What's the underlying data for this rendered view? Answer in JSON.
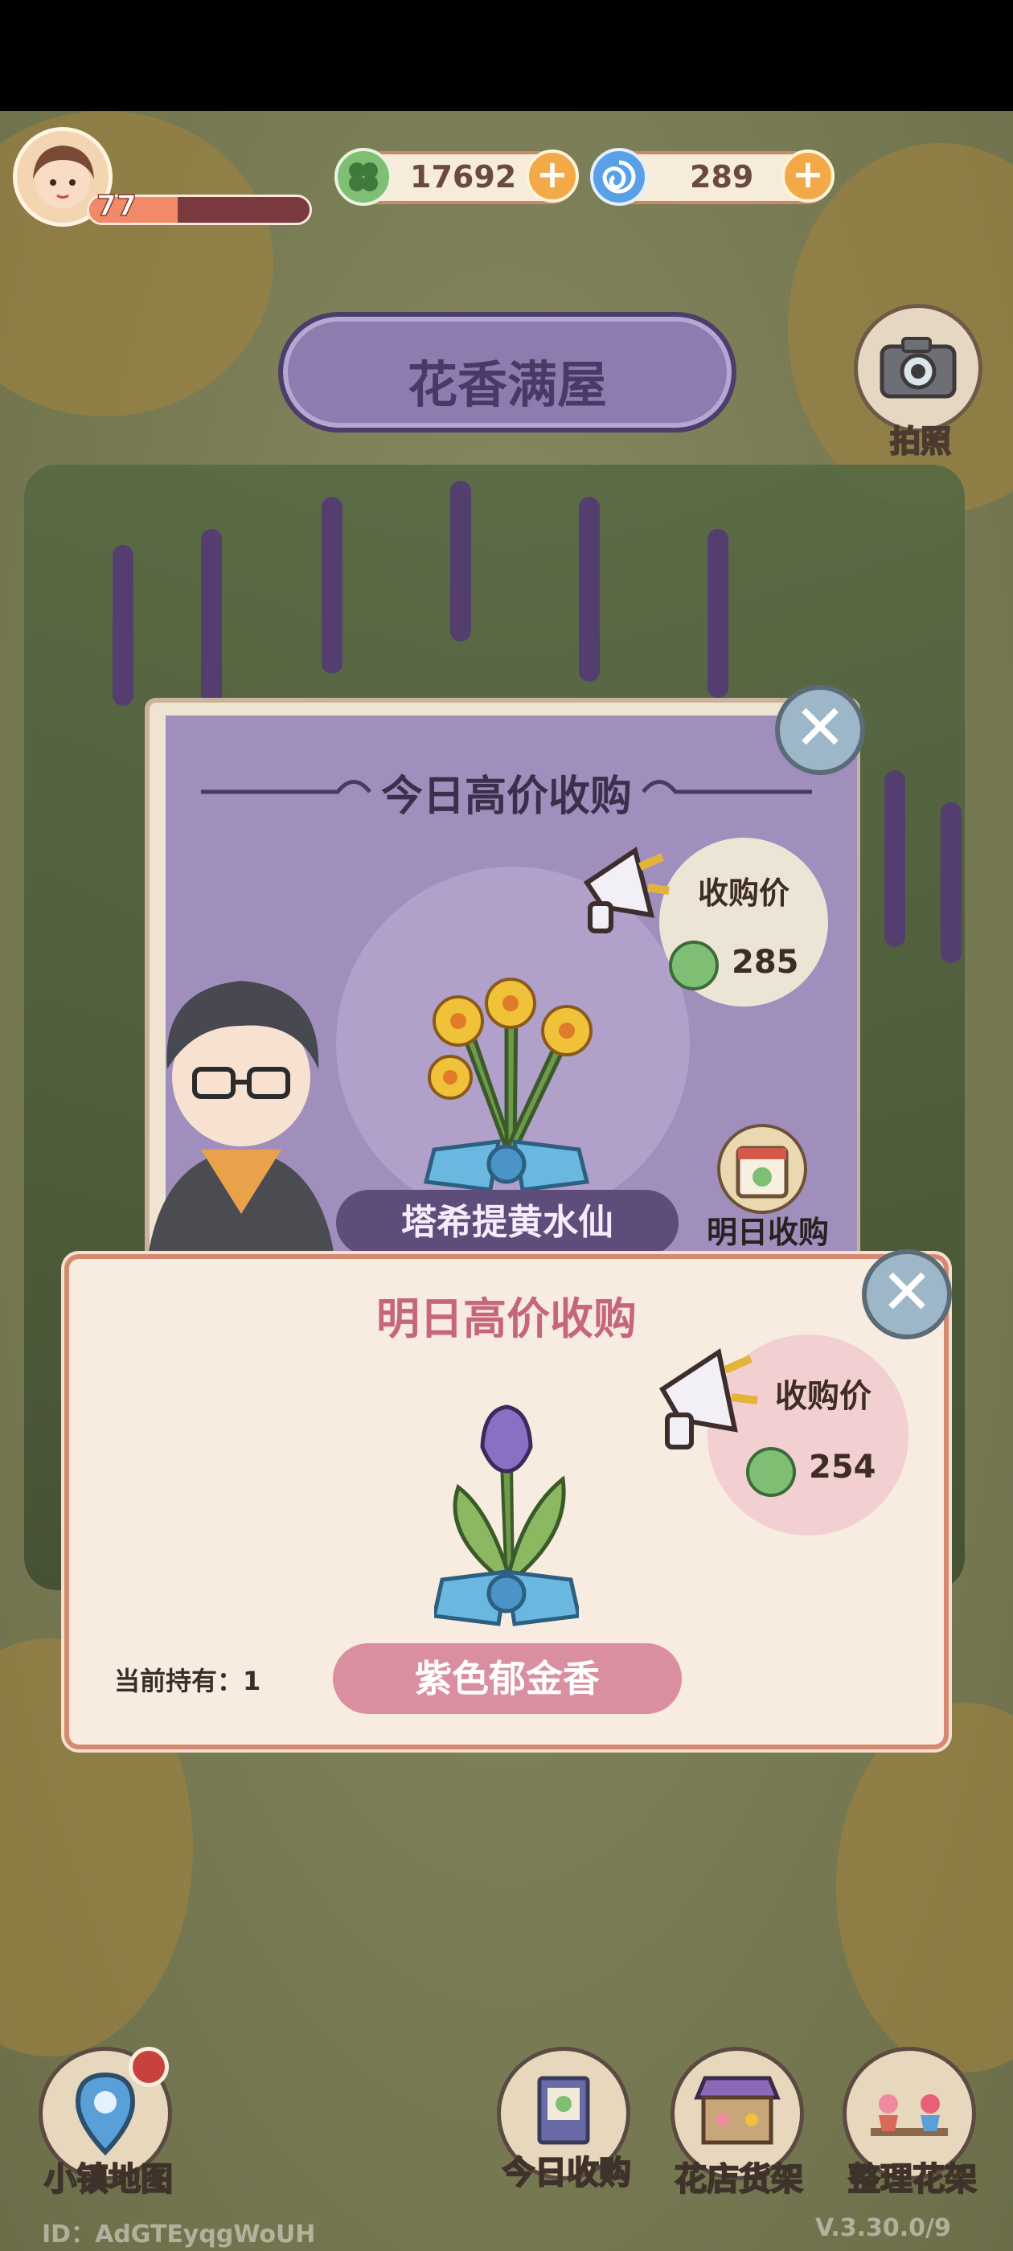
{
  "player": {
    "level": "77",
    "level_progress": 0.4
  },
  "resources": {
    "clover": {
      "value": "17692",
      "icon": "clover-coin-icon",
      "color": "#7fbf74"
    },
    "gem": {
      "value": "289",
      "icon": "blue-swirl-gem-icon",
      "color": "#5aa0e6"
    }
  },
  "header": {
    "title": "花香满屋",
    "camera_label": "拍照"
  },
  "today": {
    "title": "今日高价收购",
    "price_label": "收购价",
    "price": "285",
    "flower_name": "塔希提黄水仙",
    "tomorrow_button": "明日收购"
  },
  "tomorrow": {
    "title": "明日高价收购",
    "price_label": "收购价",
    "price": "254",
    "holding": "当前持有：1",
    "flower_name": "紫色郁金香"
  },
  "nav": {
    "map": "小镇地图",
    "today_buy": "今日收购",
    "shelf": "花店货架",
    "arrange": "整理花架"
  },
  "footer": {
    "id": "ID：AdGTEyqgWoUH",
    "version": "V.3.30.0/9"
  },
  "colors": {
    "panel_purple": "#a08fbd",
    "panel_cream": "#f7ecdf",
    "accent_pink": "#d98f9f"
  }
}
